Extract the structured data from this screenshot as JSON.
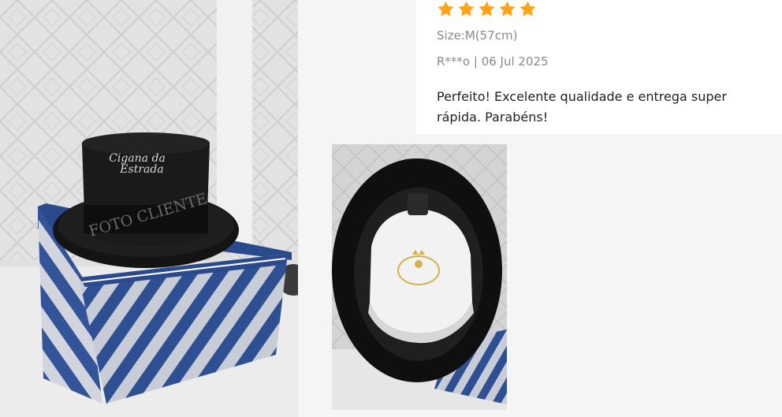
{
  "main_photo": {
    "watermark_line1": "Cigana da",
    "watermark_line2": "Estrada",
    "overlay_text": "FOTO CLIENTE"
  },
  "review": {
    "rating": 5,
    "rating_max": 5,
    "star_color": "#ffa31a",
    "size_text": "Size:M(57cm)",
    "author_date": "R***o | 06 Jul 2025",
    "body": "Perfeito! Excelente qualidade e entrega super rápida. Parabéns!"
  }
}
